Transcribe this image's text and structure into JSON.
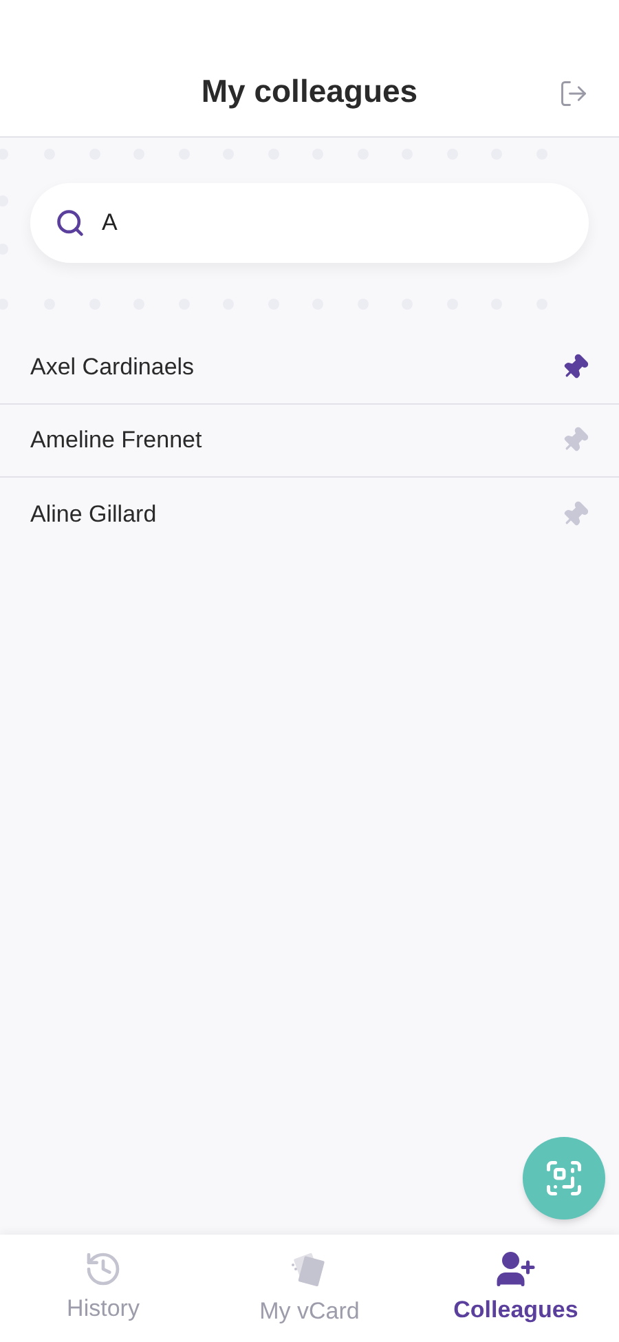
{
  "header": {
    "title": "My colleagues"
  },
  "search": {
    "value": "A"
  },
  "colleagues": [
    {
      "name": "Axel Cardinaels",
      "pinned": true
    },
    {
      "name": "Ameline Frennet",
      "pinned": false
    },
    {
      "name": "Aline Gillard",
      "pinned": false
    }
  ],
  "tabs": [
    {
      "kind": "history",
      "label": "History",
      "selected": false
    },
    {
      "kind": "vcard",
      "label": "My vCard",
      "selected": false
    },
    {
      "kind": "colleagues",
      "label": "Colleagues",
      "selected": true
    }
  ]
}
